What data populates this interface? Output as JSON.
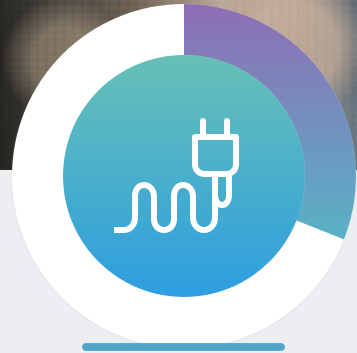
{
  "widget": {
    "progress_fraction": 0.31,
    "icon_name": "plug-icon",
    "colors": {
      "progress_top": "#8f6db4",
      "progress_bottom": "#58b2c7",
      "inner_top": "#67c0b6",
      "inner_bottom": "#2d9ee0",
      "ring_track": "#ffffff",
      "bottom_pill": "#4da6c8"
    }
  }
}
